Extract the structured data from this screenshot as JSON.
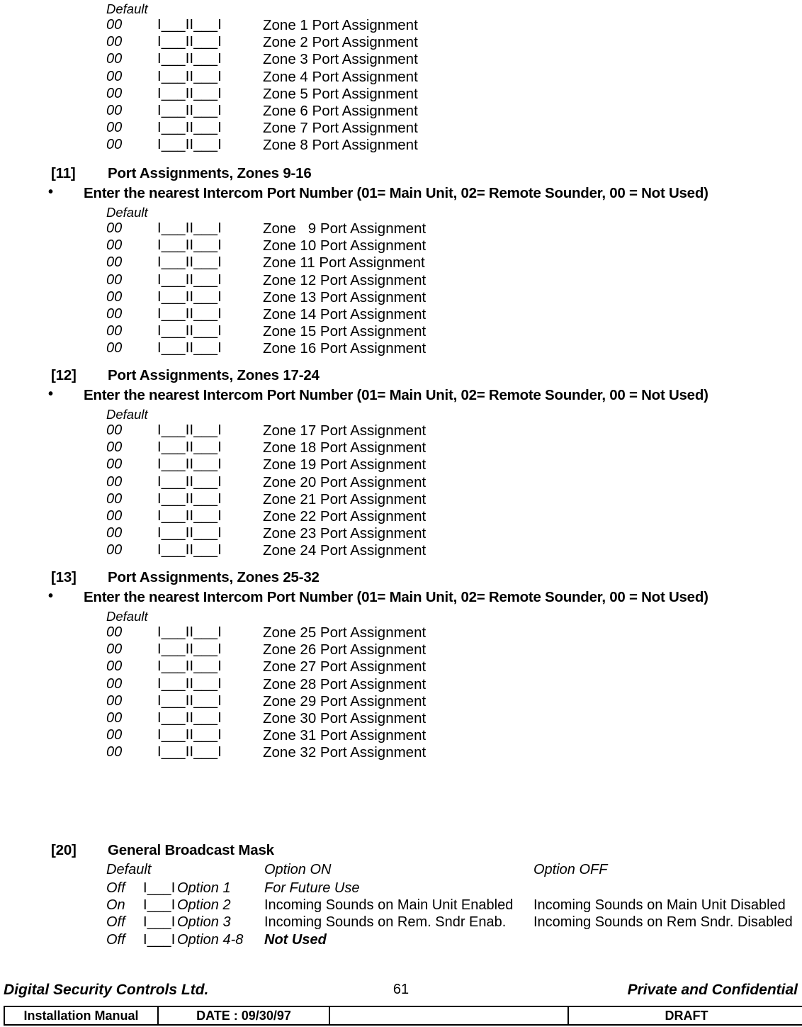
{
  "document": {
    "page_number": "61",
    "footer": {
      "company": "Digital Security Controls Ltd.",
      "confidentiality": "Private and Confidential",
      "table": {
        "manual": "Installation Manual",
        "date": "DATE :  09/30/97",
        "blank": "",
        "status": "DRAFT"
      }
    }
  },
  "common": {
    "default_label": "Default",
    "bullet_glyph": "•",
    "instruction": "Enter the nearest Intercom Port Number (01= Main Unit, 02= Remote Sounder, 00 = Not Used)",
    "default_value": "00",
    "field_mark": "I___II___I"
  },
  "sections": [
    {
      "number": "",
      "title": "",
      "show_header": false,
      "default_label": "Default",
      "rows": [
        {
          "default": "00",
          "field": "I___II___I",
          "label": "Zone 1 Port Assignment"
        },
        {
          "default": "00",
          "field": "I___II___I",
          "label": "Zone 2 Port Assignment"
        },
        {
          "default": "00",
          "field": "I___II___I",
          "label": "Zone 3 Port Assignment"
        },
        {
          "default": "00",
          "field": "I___II___I",
          "label": "Zone 4 Port Assignment"
        },
        {
          "default": "00",
          "field": "I___II___I",
          "label": "Zone 5 Port Assignment"
        },
        {
          "default": "00",
          "field": "I___II___I",
          "label": "Zone 6 Port Assignment"
        },
        {
          "default": "00",
          "field": "I___II___I",
          "label": "Zone 7 Port Assignment"
        },
        {
          "default": "00",
          "field": "I___II___I",
          "label": "Zone 8 Port Assignment"
        }
      ]
    },
    {
      "number": "[11]",
      "title": "Port Assignments, Zones 9-16",
      "show_header": true,
      "instruction": "Enter the nearest Intercom Port Number (01= Main Unit, 02= Remote Sounder, 00 = Not Used)",
      "default_label": "Default",
      "rows": [
        {
          "default": "00",
          "field": "I___II___I",
          "label": "Zone   9 Port Assignment"
        },
        {
          "default": "00",
          "field": "I___II___I",
          "label": "Zone 10 Port Assignment"
        },
        {
          "default": "00",
          "field": "I___II___I",
          "label": "Zone 11 Port Assignment"
        },
        {
          "default": "00",
          "field": "I___II___I",
          "label": "Zone 12 Port Assignment"
        },
        {
          "default": "00",
          "field": "I___II___I",
          "label": "Zone 13 Port Assignment"
        },
        {
          "default": "00",
          "field": "I___II___I",
          "label": "Zone 14 Port Assignment"
        },
        {
          "default": "00",
          "field": "I___II___I",
          "label": "Zone 15 Port Assignment"
        },
        {
          "default": "00",
          "field": "I___II___I",
          "label": "Zone 16 Port Assignment"
        }
      ]
    },
    {
      "number": "[12]",
      "title": "Port Assignments, Zones 17-24",
      "show_header": true,
      "instruction": "Enter the nearest Intercom Port Number (01= Main Unit, 02= Remote Sounder, 00 = Not Used)",
      "default_label": "Default",
      "rows": [
        {
          "default": "00",
          "field": "I___II___I",
          "label": "Zone 17 Port Assignment"
        },
        {
          "default": "00",
          "field": "I___II___I",
          "label": "Zone 18 Port Assignment"
        },
        {
          "default": "00",
          "field": "I___II___I",
          "label": "Zone 19 Port Assignment"
        },
        {
          "default": "00",
          "field": "I___II___I",
          "label": "Zone 20 Port Assignment"
        },
        {
          "default": "00",
          "field": "I___II___I",
          "label": "Zone 21 Port Assignment"
        },
        {
          "default": "00",
          "field": "I___II___I",
          "label": "Zone 22 Port Assignment"
        },
        {
          "default": "00",
          "field": "I___II___I",
          "label": "Zone 23 Port Assignment"
        },
        {
          "default": "00",
          "field": "I___II___I",
          "label": "Zone 24 Port Assignment"
        }
      ]
    },
    {
      "number": "[13]",
      "title": "Port Assignments, Zones 25-32",
      "show_header": true,
      "instruction": "Enter the nearest Intercom Port Number (01= Main Unit, 02= Remote Sounder, 00 = Not Used)",
      "default_label": "Default",
      "rows": [
        {
          "default": "00",
          "field": "I___II___I",
          "label": "Zone 25 Port Assignment"
        },
        {
          "default": "00",
          "field": "I___II___I",
          "label": "Zone 26 Port Assignment"
        },
        {
          "default": "00",
          "field": "I___II___I",
          "label": "Zone 27 Port Assignment"
        },
        {
          "default": "00",
          "field": "I___II___I",
          "label": "Zone 28 Port Assignment"
        },
        {
          "default": "00",
          "field": "I___II___I",
          "label": "Zone 29 Port Assignment"
        },
        {
          "default": "00",
          "field": "I___II___I",
          "label": "Zone 30 Port Assignment"
        },
        {
          "default": "00",
          "field": "I___II___I",
          "label": "Zone 31 Port Assignment"
        },
        {
          "default": "00",
          "field": "I___II___I",
          "label": "Zone 32 Port Assignment"
        }
      ]
    }
  ],
  "broadcast_mask": {
    "number": "[20]",
    "title": "General Broadcast Mask",
    "col_default": "Default",
    "col_option_on": "Option ON",
    "col_option_off": "Option OFF",
    "rows": [
      {
        "default": "Off",
        "field": "I___I",
        "option": "Option 1",
        "on": "For Future Use",
        "on_style": "italic",
        "off": ""
      },
      {
        "default": "On",
        "field": "I___I",
        "option": "Option 2",
        "on": "Incoming Sounds on Main Unit Enabled",
        "on_style": "normal",
        "off": "Incoming Sounds on Main Unit Disabled"
      },
      {
        "default": "Off",
        "field": "I___I",
        "option": "Option 3",
        "on": "Incoming Sounds on Rem. Sndr Enab.",
        "on_style": "normal",
        "off": "Incoming Sounds on Rem Sndr. Disabled"
      },
      {
        "default": "Off",
        "field": "I___I",
        "option": "Option 4-8",
        "on": "Not Used",
        "on_style": "bolditalic",
        "off": ""
      }
    ]
  }
}
